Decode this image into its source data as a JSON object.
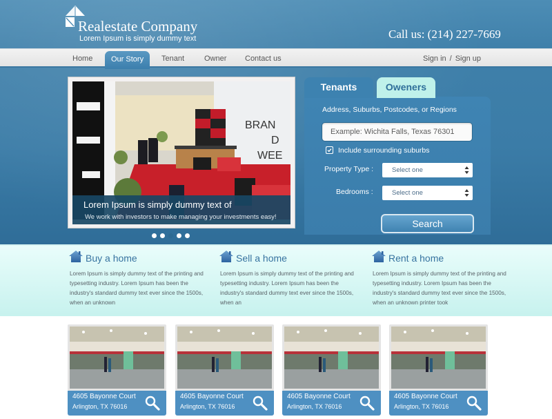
{
  "header": {
    "company_name": "Realestate Company",
    "tagline": "Lorem Ipsum is simply dummy text",
    "phone": "Call us: (214) 227-7669",
    "logo_icon": "house-kite-logo-icon"
  },
  "nav": {
    "items": [
      {
        "label": "Home",
        "active": false
      },
      {
        "label": "Our Story",
        "active": true
      },
      {
        "label": "Tenant",
        "active": false
      },
      {
        "label": "Owner",
        "active": false
      },
      {
        "label": "Contact us",
        "active": false
      }
    ],
    "sign_in": "Sign in",
    "separator": "/",
    "sign_up": "Sign up"
  },
  "slider": {
    "caption_title": "Lorem Ipsum is simply dummy text of",
    "caption_subtitle": "We work with investors to make managing your investments easy!",
    "slide_count": 5,
    "current_slide": 3
  },
  "search": {
    "tabs": [
      {
        "label": "Tenants",
        "active": true
      },
      {
        "label": "Oweners",
        "active": false
      }
    ],
    "location_label": "Address, Suburbs, Postcodes, or Regions",
    "location_placeholder": "Example: Wichita Falls, Texas 76301",
    "location_value": "",
    "include_suburbs_label": "Include surrounding suburbs",
    "include_suburbs_checked": true,
    "property_type_label": "Property Type :",
    "property_type_value": "Select one",
    "bedrooms_label": "Bedrooms :",
    "bedrooms_value": "Select one",
    "search_button": "Search"
  },
  "features": [
    {
      "title": "Buy a home",
      "icon": "house-icon",
      "text": "Lorem Ipsum is simply dummy text of the printing and typesetting industry. Lorem Ipsum has been the industry's standard dummy text ever since the 1500s, when an unknown"
    },
    {
      "title": "Sell a home",
      "icon": "house-icon",
      "text": "Lorem Ipsum is simply dummy text of the printing and typesetting industry. Lorem Ipsum has been the industry's standard dummy text ever since the 1500s, when an"
    },
    {
      "title": "Rent a home",
      "icon": "house-icon",
      "text": "Lorem Ipsum is simply dummy text of the printing and typesetting industry. Lorem Ipsum has been the industry's standard dummy text ever since the 1500s, when an unknown printer took"
    }
  ],
  "listings": [
    {
      "address": "4605 Bayonne Court",
      "city": "Arlington, TX 76016"
    },
    {
      "address": "4605 Bayonne Court",
      "city": "Arlington, TX 76016"
    },
    {
      "address": "4605 Bayonne Court",
      "city": "Arlington, TX 76016"
    },
    {
      "address": "4605 Bayonne Court",
      "city": "Arlington, TX 76016"
    }
  ],
  "colors": {
    "brand_blue": "#3d82b0",
    "nav_bg": "#e8e8e8",
    "owners_tab": "#bff1ea",
    "feature_band": "#d6f7f3",
    "card_info": "#4e90c2",
    "feature_title": "#3773a0"
  }
}
